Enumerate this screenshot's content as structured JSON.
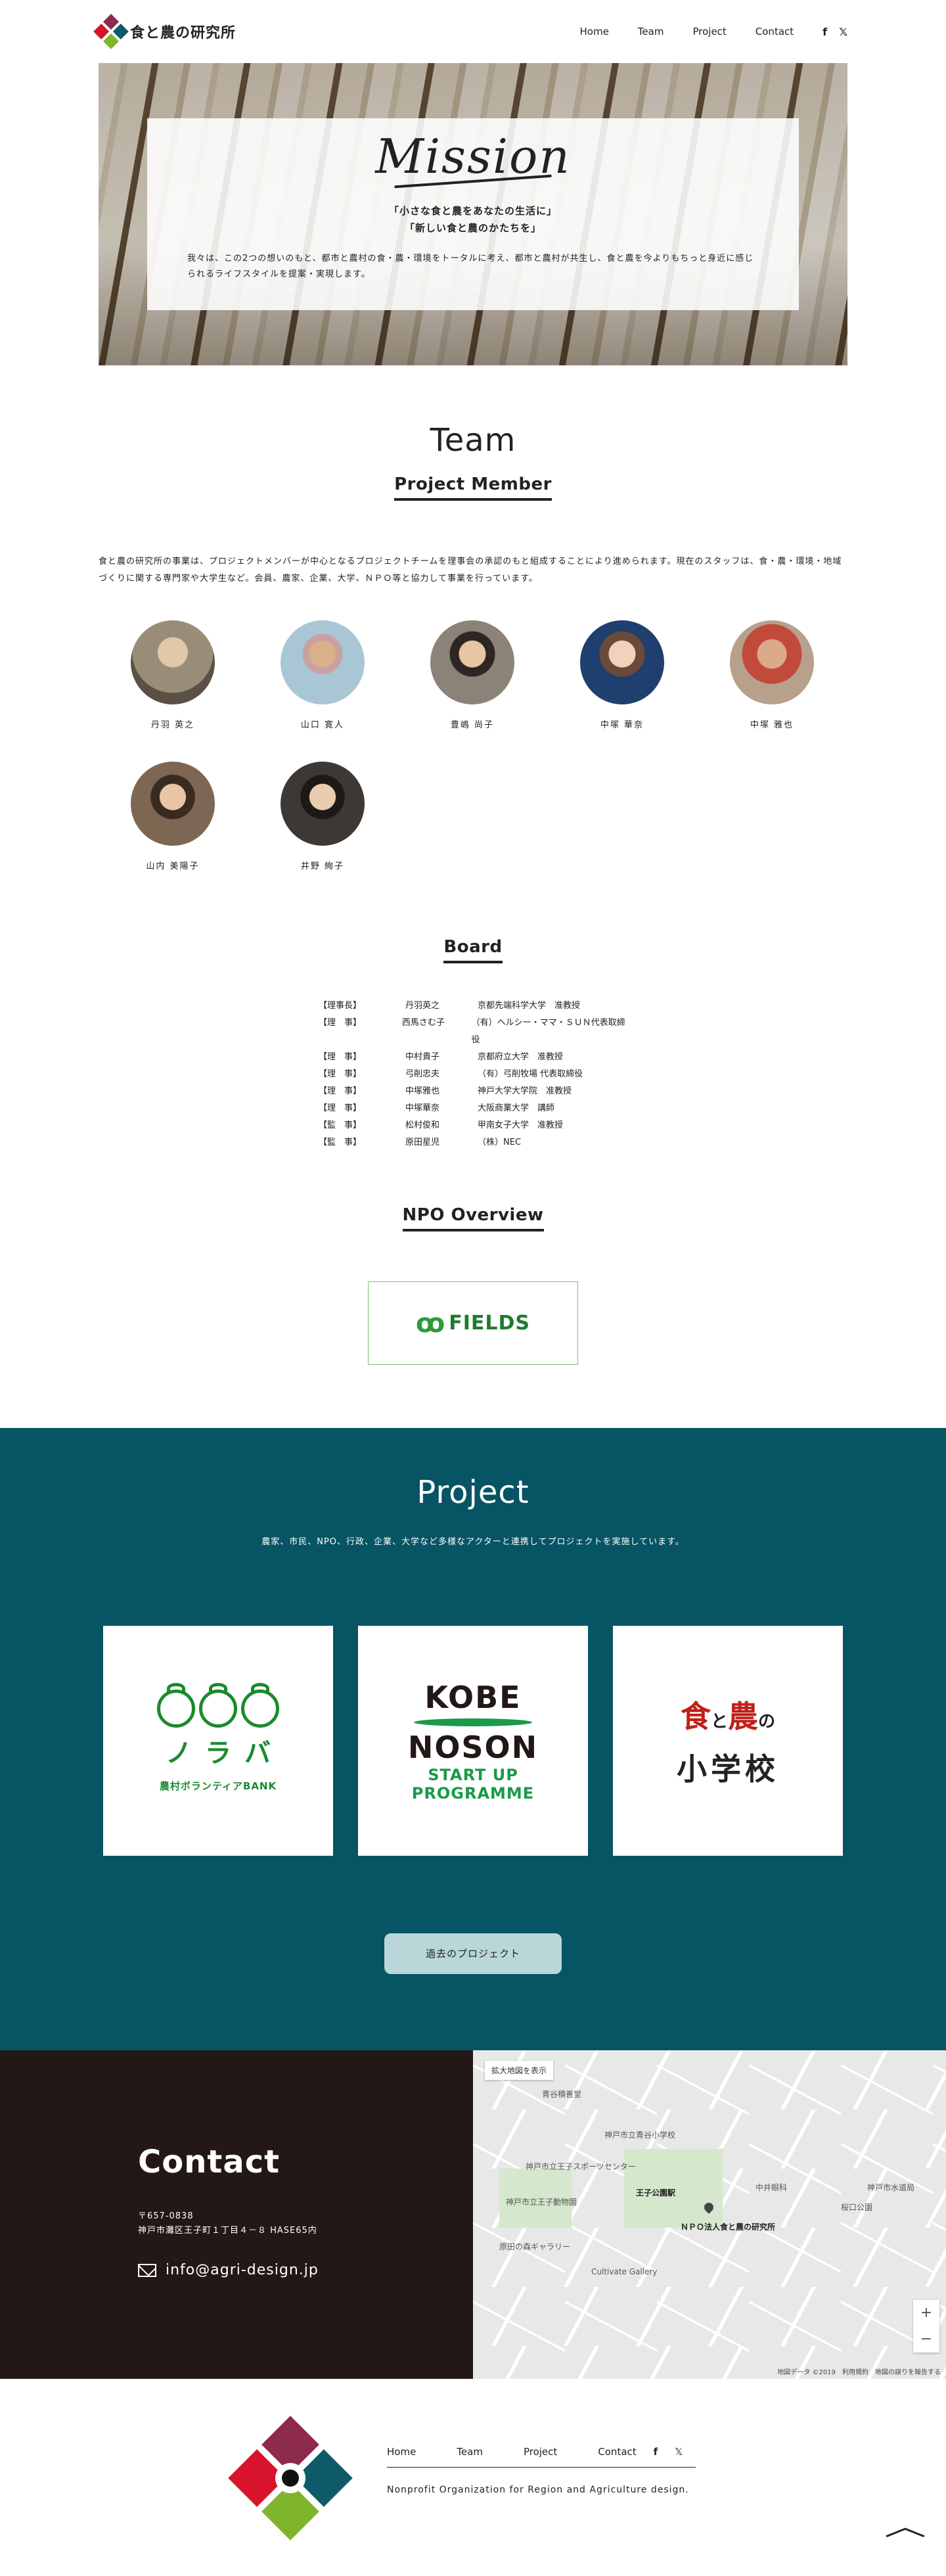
{
  "header": {
    "logo_text": "食と農の研究所",
    "nav": [
      "Home",
      "Team",
      "Project",
      "Contact"
    ],
    "social": [
      "f",
      "𝕏"
    ]
  },
  "hero": {
    "title": "Mission",
    "tagline_1": "「小さな食と農をあなたの生活に」",
    "tagline_2": "「新しい食と農のかたちを」",
    "desc": "我々は、この2つの想いのもと、都市と農村の食・農・環境をトータルに考え、都市と農村が共生し、食と農を今よりもちっと身近に感じられるライフスタイルを提案・実現します。"
  },
  "team": {
    "title": "Team",
    "member_heading": "Project Member",
    "desc": "食と農の研究所の事業は、プロジェクトメンバーが中心となるプロジェクトチームを理事会の承認のもと組成することにより進められます。現在のスタッフは、食・農・環境・地域づくりに関する専門家や大学生など。会員、農家、企業、大学、ＮＰＯ等と協力して事業を行っています。",
    "members": [
      {
        "name": "丹羽 英之",
        "color": "#9a8d78"
      },
      {
        "name": "山口 寛人",
        "color": "#a9c6d4"
      },
      {
        "name": "豊嶋 尚子",
        "color": "#8c8378"
      },
      {
        "name": "中塚 華奈",
        "color": "#1f3f6e"
      },
      {
        "name": "中塚 雅也",
        "color": "#b7a08c"
      },
      {
        "name": "山内 美陽子",
        "color": "#7d6652"
      },
      {
        "name": "井野 絢子",
        "color": "#3d3834"
      }
    ],
    "board_heading": "Board",
    "board": [
      {
        "role": "【理事長】",
        "name": "丹羽英之",
        "org": "京都先端科学大学　准教授"
      },
      {
        "role": "【理　事】",
        "name": "西馬さむ子",
        "org": "（有）ヘルシー・ママ・ＳＵＮ代表取締役"
      },
      {
        "role": "【理　事】",
        "name": "中村貴子",
        "org": "京都府立大学　准教授"
      },
      {
        "role": "【理　事】",
        "name": "弓削忠夫",
        "org": "（有）弓削牧場 代表取締役"
      },
      {
        "role": "【理　事】",
        "name": "中塚雅也",
        "org": "神戸大学大学院　准教授"
      },
      {
        "role": "【理　事】",
        "name": "中塚華奈",
        "org": "大阪商業大学　講師"
      },
      {
        "role": "【監　事】",
        "name": "松村俊和",
        "org": "甲南女子大学　准教授"
      },
      {
        "role": "【監　事】",
        "name": "原田星児",
        "org": "（株）NEC"
      }
    ],
    "npo_heading": "NPO Overview",
    "npo_logo": "FIELDS"
  },
  "project": {
    "title": "Project",
    "desc": "農家、市民、NPO、行政、企業、大学など多様なアクターと連携してプロジェクトを実施しています。",
    "noraba_kana": [
      "ノ",
      "ラ",
      "バ"
    ],
    "noraba_line": "農村ボランティアBANK",
    "kobe_title_1": "KOBE",
    "kobe_title_2": "NOSON",
    "kobe_sub_1": "START UP",
    "kobe_sub_2": "PROGRAMME",
    "gakko_a": "食",
    "gakko_to": "と",
    "gakko_b": "農",
    "gakko_no": "の",
    "gakko_bottom": "小学校",
    "past_button": "過去のプロジェクト"
  },
  "contact": {
    "title": "Contact",
    "zip": "〒657-0838",
    "address": "神戸市灘区王子町１丁目４－８ HASE65内",
    "email": "info@agri-design.jp"
  },
  "map": {
    "expand": "拡大地図を表示",
    "labels": [
      "王子公園駅",
      "ＮＰＯ法人食と農の研究所",
      "神戸市立王子スポーツセンター",
      "神戸市立王子動物園",
      "青谷積善堂",
      "原田の森ギャラリー",
      "神戸市立青谷小学校",
      "Cultivate Gallery",
      "中井眼科",
      "桜口公園",
      "神戸市水道局"
    ],
    "footer": "地図データ ©2019　利用規約　地図の誤りを報告する"
  },
  "footer": {
    "nav": [
      "Home",
      "Team",
      "Project",
      "Contact"
    ],
    "social": [
      "f",
      "𝕏"
    ],
    "tagline": "Nonprofit Organization for Region and Agriculture design."
  }
}
